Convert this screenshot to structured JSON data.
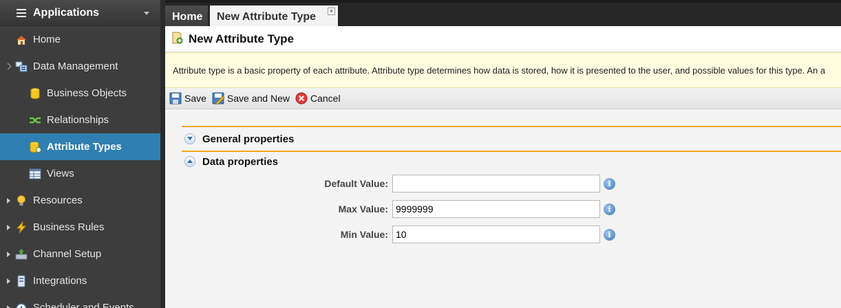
{
  "sidebar": {
    "header_title": "Applications",
    "items": [
      {
        "label": "Home",
        "icon": "home-icon"
      },
      {
        "label": "Data Management",
        "icon": "data-management-icon"
      },
      {
        "label": "Business Objects",
        "icon": "business-objects-icon"
      },
      {
        "label": "Relationships",
        "icon": "relationships-icon"
      },
      {
        "label": "Attribute Types",
        "icon": "attribute-types-icon"
      },
      {
        "label": "Views",
        "icon": "views-icon"
      },
      {
        "label": "Resources",
        "icon": "resources-icon"
      },
      {
        "label": "Business Rules",
        "icon": "business-rules-icon"
      },
      {
        "label": "Channel Setup",
        "icon": "channel-setup-icon"
      },
      {
        "label": "Integrations",
        "icon": "integrations-icon"
      },
      {
        "label": "Scheduler and Events",
        "icon": "scheduler-icon"
      }
    ]
  },
  "tabs": {
    "home": "Home",
    "current": "New Attribute Type",
    "close_glyph": "×"
  },
  "page": {
    "title": "New Attribute Type",
    "description": "Attribute type is a basic property of each attribute. Attribute type determines how data is stored, how it is presented to the user, and possible values for this type. An a"
  },
  "toolbar": {
    "save": "Save",
    "save_and_new": "Save and New",
    "cancel": "Cancel"
  },
  "sections": {
    "general": "General properties",
    "data": "Data properties"
  },
  "fields": {
    "default_value": {
      "label": "Default Value:",
      "value": ""
    },
    "max_value": {
      "label": "Max Value:",
      "value": "9999999"
    },
    "min_value": {
      "label": "Min Value:",
      "value": "10"
    }
  },
  "colors": {
    "sidebar_bg": "#3d3d3d",
    "active_item": "#2f7fb3",
    "section_line": "#f0a81e",
    "info_box_bg": "#fefde0"
  }
}
